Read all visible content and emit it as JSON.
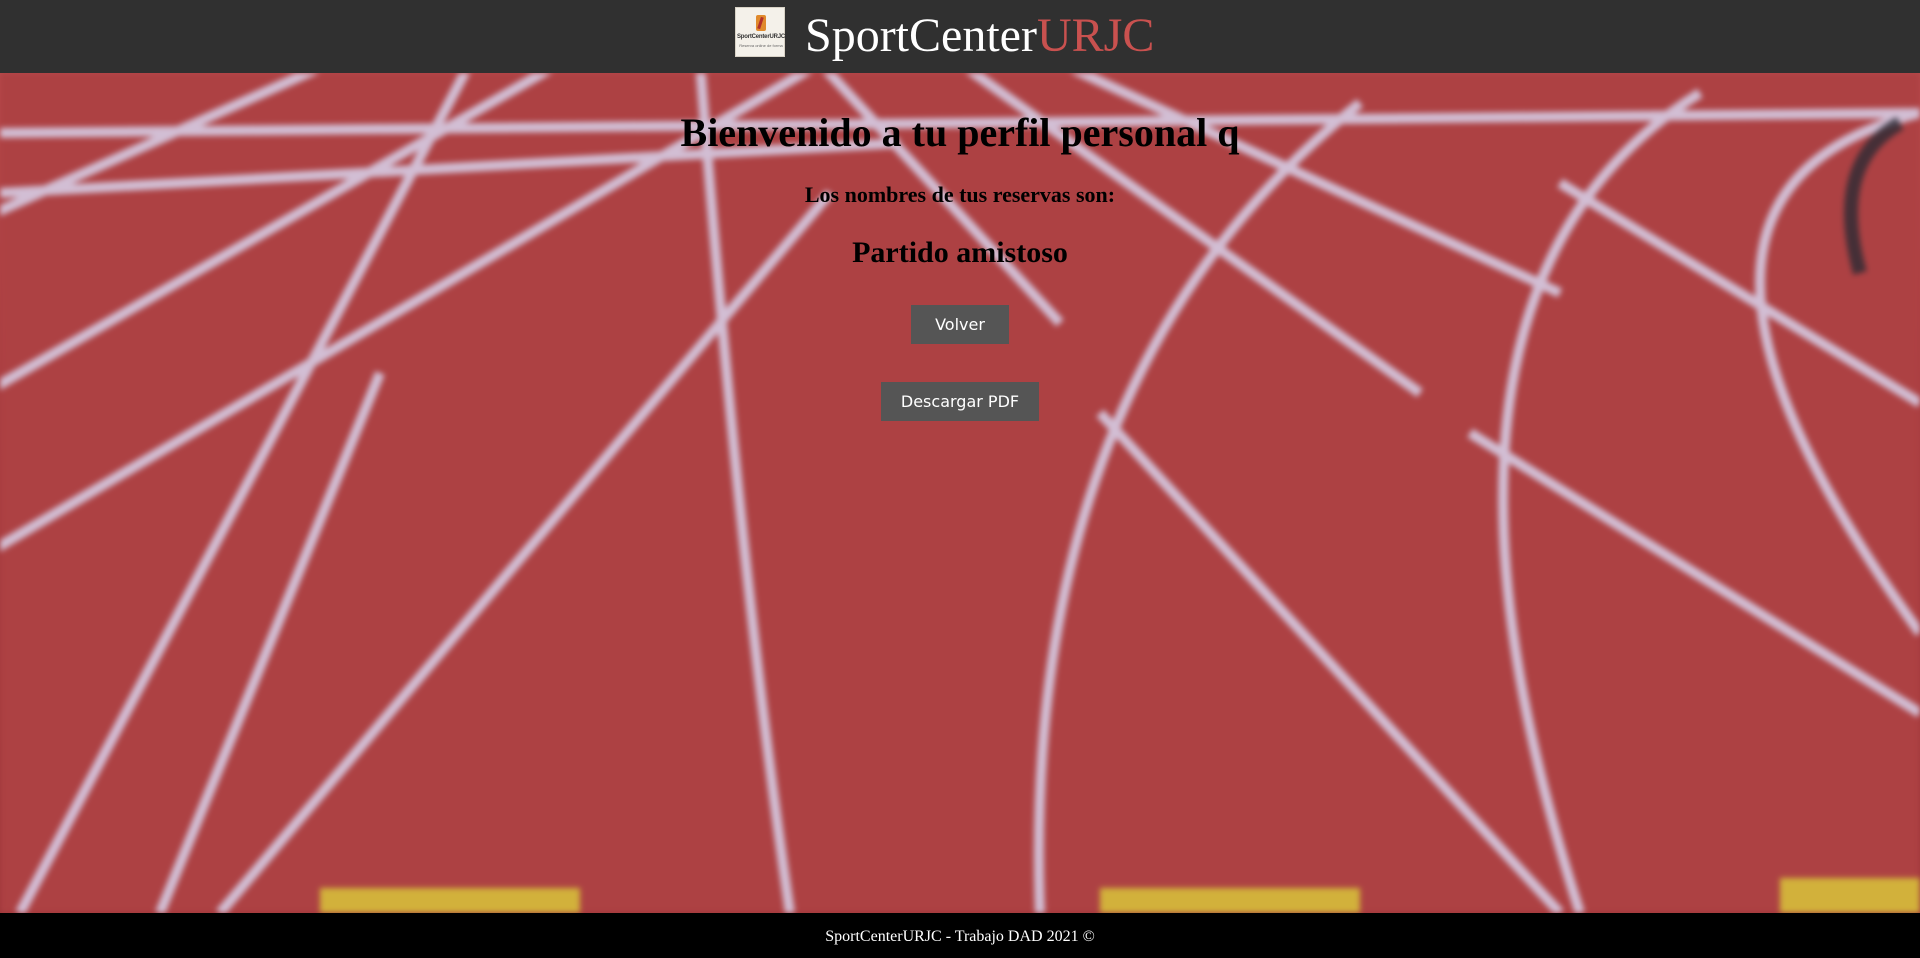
{
  "header": {
    "logo_text": "SportCenterURJC",
    "logo_subtext": "Reserva online de forma",
    "brand_primary": "SportCenter",
    "brand_accent": "URJC"
  },
  "main": {
    "title": "Bienvenido a tu perfil personal q",
    "subtitle": "Los nombres de tus reservas son:",
    "reservations": [
      "Partido amistoso"
    ],
    "back_button": "Volver",
    "pdf_button": "Descargar PDF"
  },
  "footer": {
    "text": "SportCenterURJC - Trabajo DAD 2021 ©"
  },
  "colors": {
    "header_bg": "#303030",
    "brand_accent": "#c9514f",
    "button_bg": "#555555",
    "footer_bg": "#000000",
    "track": "#a83c3f"
  }
}
